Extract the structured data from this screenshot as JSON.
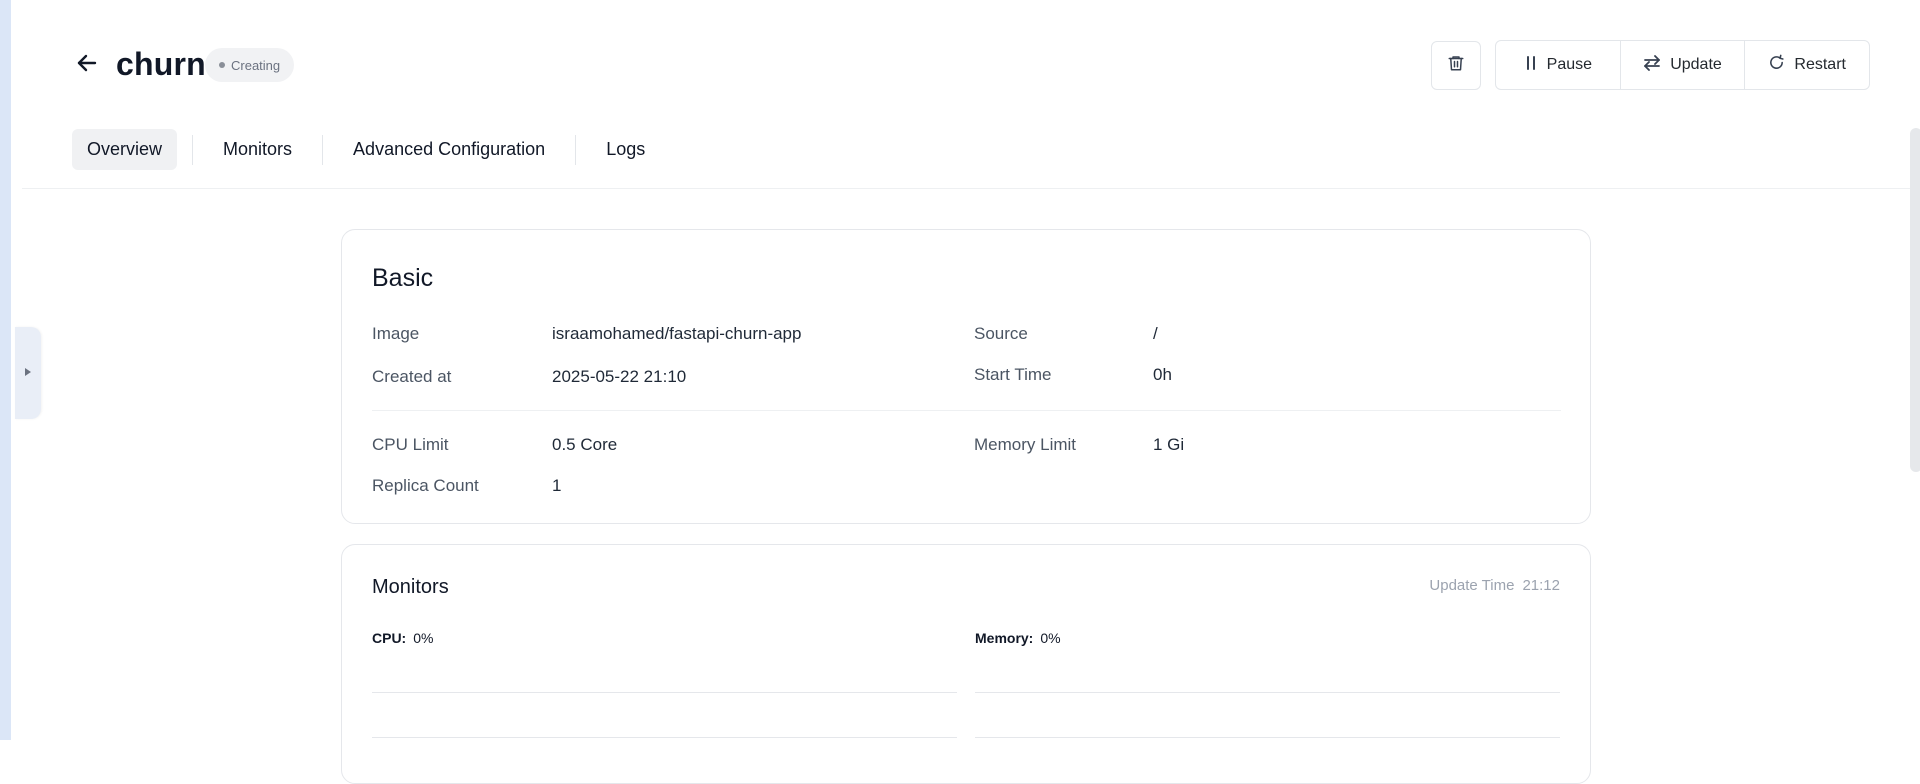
{
  "header": {
    "title": "churn",
    "status": "Creating"
  },
  "actions": {
    "pause": "Pause",
    "update": "Update",
    "restart": "Restart"
  },
  "tabs": [
    {
      "label": "Overview",
      "active": true
    },
    {
      "label": "Monitors",
      "active": false
    },
    {
      "label": "Advanced Configuration",
      "active": false
    },
    {
      "label": "Logs",
      "active": false
    }
  ],
  "basic": {
    "title": "Basic",
    "image_label": "Image",
    "image_value": "israamohamed/fastapi-churn-app",
    "created_label": "Created at",
    "created_value": "2025-05-22 21:10",
    "source_label": "Source",
    "source_value": "/",
    "start_label": "Start Time",
    "start_value": "0h",
    "cpu_label": "CPU Limit",
    "cpu_value": "0.5 Core",
    "memory_label": "Memory Limit",
    "memory_value": "1 Gi",
    "replica_label": "Replica Count",
    "replica_value": "1"
  },
  "monitors": {
    "title": "Monitors",
    "update_time_label": "Update Time",
    "update_time_value": "21:12",
    "cpu_label": "CPU:",
    "cpu_value": "0%",
    "memory_label": "Memory:",
    "memory_value": "0%"
  },
  "colors": {
    "accent_bg": "#dbe6f7",
    "badge_bg": "#f1f2f4",
    "border": "#e5e7eb"
  }
}
